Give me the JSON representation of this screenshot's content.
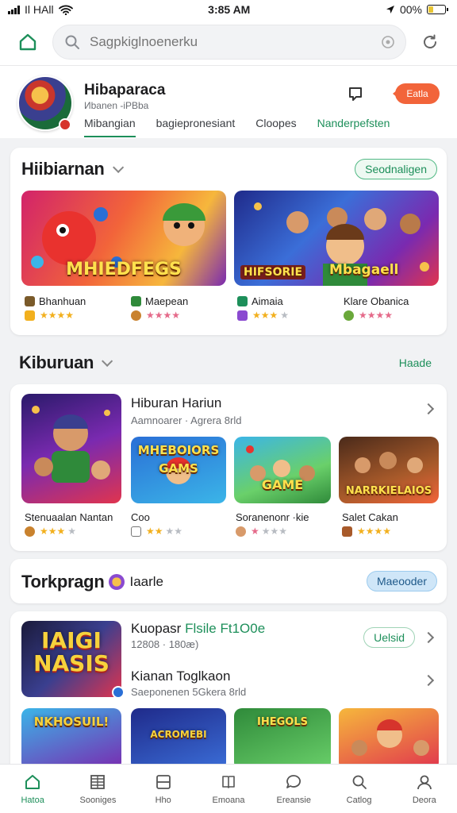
{
  "status": {
    "carrier": "Il НАll",
    "time": "3:85 AM",
    "battery": "00%"
  },
  "search": {
    "placeholder": "Sagpkiglnoenerku"
  },
  "profile": {
    "name": "Hibaparaca",
    "subtitle": "Иbanen -іРВba",
    "tabs": [
      "Mibangian",
      "bagiepronesiant",
      "Cloopes",
      "Nanderpefsten"
    ],
    "edit_label": "Eatla"
  },
  "section1": {
    "title": "Hiibiarnan",
    "pill": "Seodnaligen",
    "apps": [
      {
        "name": "Bhanhuan",
        "thumb_text": ""
      },
      {
        "name": "Maepean",
        "thumb_text": "MHIEDFEGS"
      },
      {
        "name": "Aimaia",
        "thumb_text": "HIFSORIE"
      },
      {
        "name": "Klare Obanica",
        "thumb_text": "Mbagaell"
      }
    ]
  },
  "section2": {
    "title": "Kiburuan",
    "pill": "Haade",
    "feature_title": "Hiburan Hariun",
    "feature_sub": "Aamnoarer · Agrera 8rld",
    "feature_thumb_label": "Stenuaalan Nantan",
    "apps": [
      {
        "name": "Coo",
        "thumb_text": "MHEBOIORS GAMS"
      },
      {
        "name": "Soranenonr ·kie",
        "thumb_text": "GAME"
      },
      {
        "name": "Salet Cakan",
        "thumb_text": "NARRKIELAIOS"
      }
    ]
  },
  "section3": {
    "title": "Torkpragn",
    "title_suffix": "Iaarle",
    "pill": "Maeooder",
    "rows": [
      {
        "title": "Kuopasr",
        "title_accent": "Flsile Ft1O0e",
        "sub": "12808 · 180æ)",
        "action": "Uelsid"
      },
      {
        "title": "Kianan Toglkaon",
        "sub": "Saeponenen 5Gkera 8rld"
      }
    ],
    "feature_thumb_text": "IAIGI NASIS",
    "thumbs": [
      "NKHOSUIL!",
      "ACROMEBI",
      "IHEGOLS",
      ""
    ]
  },
  "nav": [
    {
      "label": "Hatoa",
      "icon": "home-icon"
    },
    {
      "label": "Sooniges",
      "icon": "grid-icon"
    },
    {
      "label": "Hho",
      "icon": "window-icon"
    },
    {
      "label": "Emoana",
      "icon": "book-icon"
    },
    {
      "label": "Ereansie",
      "icon": "chat-icon"
    },
    {
      "label": "Catlog",
      "icon": "search-icon"
    },
    {
      "label": "Deora",
      "icon": "profile-icon"
    }
  ],
  "colors": {
    "accent": "#1d8f5a",
    "edit": "#f2643a",
    "star": "#f2b01e"
  }
}
